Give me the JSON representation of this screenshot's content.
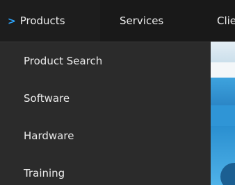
{
  "nav": {
    "active_marker": ">",
    "items": [
      {
        "label": "Products"
      },
      {
        "label": "Services"
      },
      {
        "label": "Clie"
      }
    ]
  },
  "dropdown": {
    "items": [
      {
        "label": "Product Search"
      },
      {
        "label": "Software"
      },
      {
        "label": "Hardware"
      },
      {
        "label": "Training"
      }
    ]
  },
  "colors": {
    "nav_background": "#191919",
    "dropdown_background": "#2b2b2b",
    "accent": "#2ea7ff",
    "text": "#ececec"
  }
}
